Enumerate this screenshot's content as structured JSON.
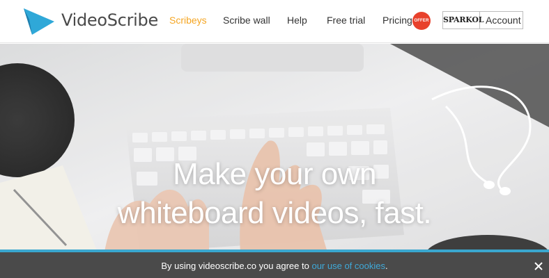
{
  "brand": {
    "name": "VideoScribe",
    "color": "#2fa8d8"
  },
  "nav": {
    "scribeys": "Scribeys",
    "scribe_wall": "Scribe wall",
    "help": "Help",
    "free_trial": "Free trial",
    "pricing": "Pricing",
    "offer_badge": "OFFER",
    "active_color": "#f5a623"
  },
  "account": {
    "brand_logo_text": "SPARKOL",
    "label": "Account"
  },
  "hero": {
    "title_line1": "Make your own",
    "title_line2": "whiteboard videos, fast.",
    "accent_color": "#3aa7cf"
  },
  "cookie_bar": {
    "text": "By using videoscribe.co you agree to ",
    "link": "our use of cookies",
    "suffix": ".",
    "close_icon": "close-icon",
    "link_color": "#3fa9d8"
  }
}
